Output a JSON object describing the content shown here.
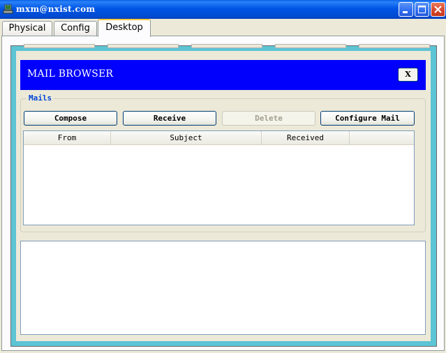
{
  "window": {
    "title": "mxm@nxist.com",
    "icon": "pc-app-icon"
  },
  "tabs": [
    {
      "label": "Physical",
      "active": false
    },
    {
      "label": "Config",
      "active": false
    },
    {
      "label": "Desktop",
      "active": true
    }
  ],
  "mail_browser": {
    "title": "MAIL BROWSER",
    "close_label": "X",
    "group_label": "Mails",
    "buttons": {
      "compose": "Compose",
      "receive": "Receive",
      "delete": "Delete",
      "configure": "Configure Mail"
    },
    "columns": [
      "From",
      "Subject",
      "Received",
      ""
    ],
    "rows": [],
    "preview_text": ""
  },
  "colors": {
    "header_bg": "#0000fc",
    "desktop_bg": "#5cc4d4",
    "legend_text": "#0046d5"
  }
}
